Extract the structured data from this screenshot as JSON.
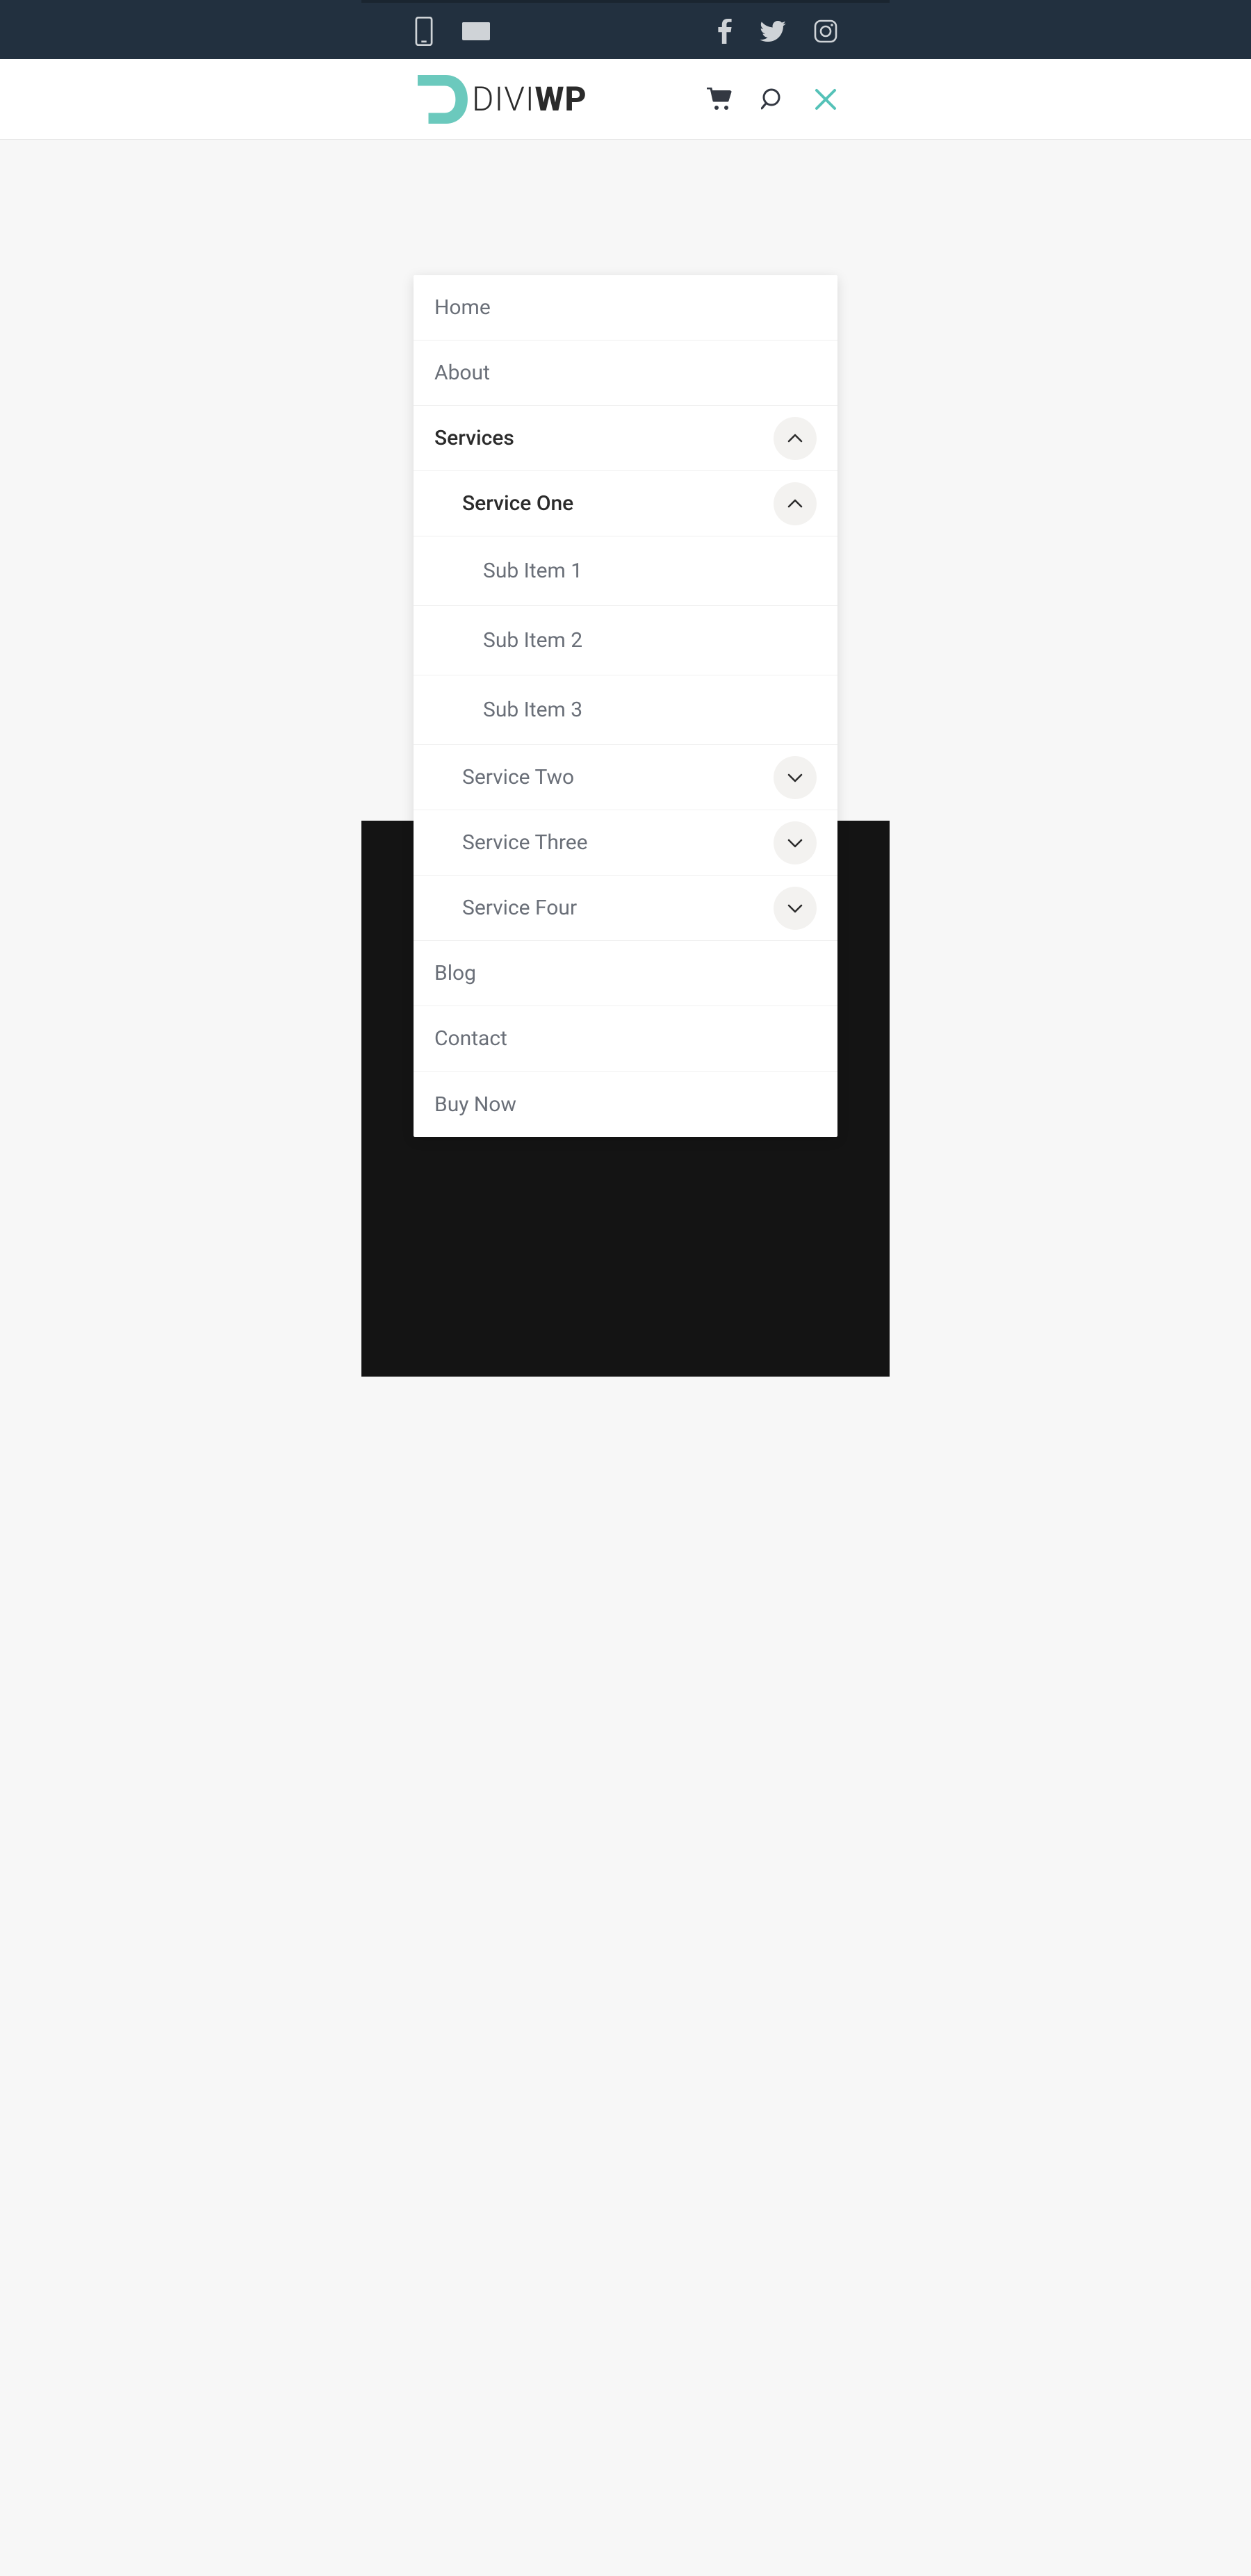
{
  "logo": {
    "divi": "DIVI",
    "wp": "WP"
  },
  "menu": {
    "home": "Home",
    "about": "About",
    "services": "Services",
    "service_one": "Service One",
    "sub1": "Sub Item 1",
    "sub2": "Sub Item 2",
    "sub3": "Sub Item 3",
    "service_two": "Service Two",
    "service_three": "Service Three",
    "service_four": "Service Four",
    "blog": "Blog",
    "contact": "Contact",
    "buy_now": "Buy Now"
  }
}
